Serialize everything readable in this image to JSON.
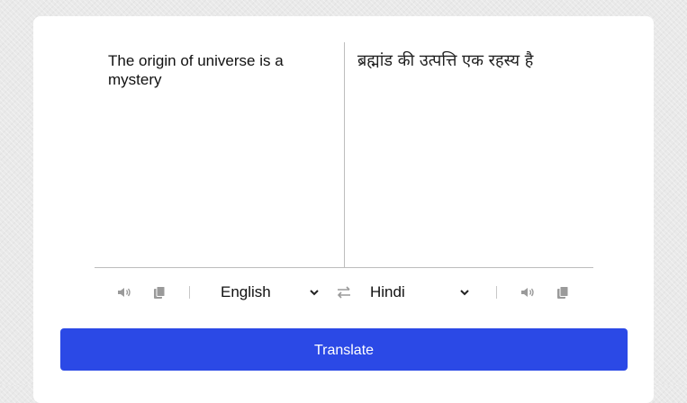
{
  "source": {
    "text": "The origin of universe is a mystery"
  },
  "target": {
    "text": "ब्रह्मांड की उत्पत्ति एक रहस्य है"
  },
  "controls": {
    "source_language": "English",
    "target_language": "Hindi",
    "icons": [
      "speaker-icon",
      "copy-icon",
      "chevron-down-icon",
      "swap-icon",
      "chevron-down-icon",
      "speaker-icon",
      "copy-icon"
    ]
  },
  "actions": {
    "translate_label": "Translate"
  },
  "colors": {
    "accent": "#2b49e6",
    "icon": "#9a9a9a",
    "divider": "#bdbdbd"
  }
}
